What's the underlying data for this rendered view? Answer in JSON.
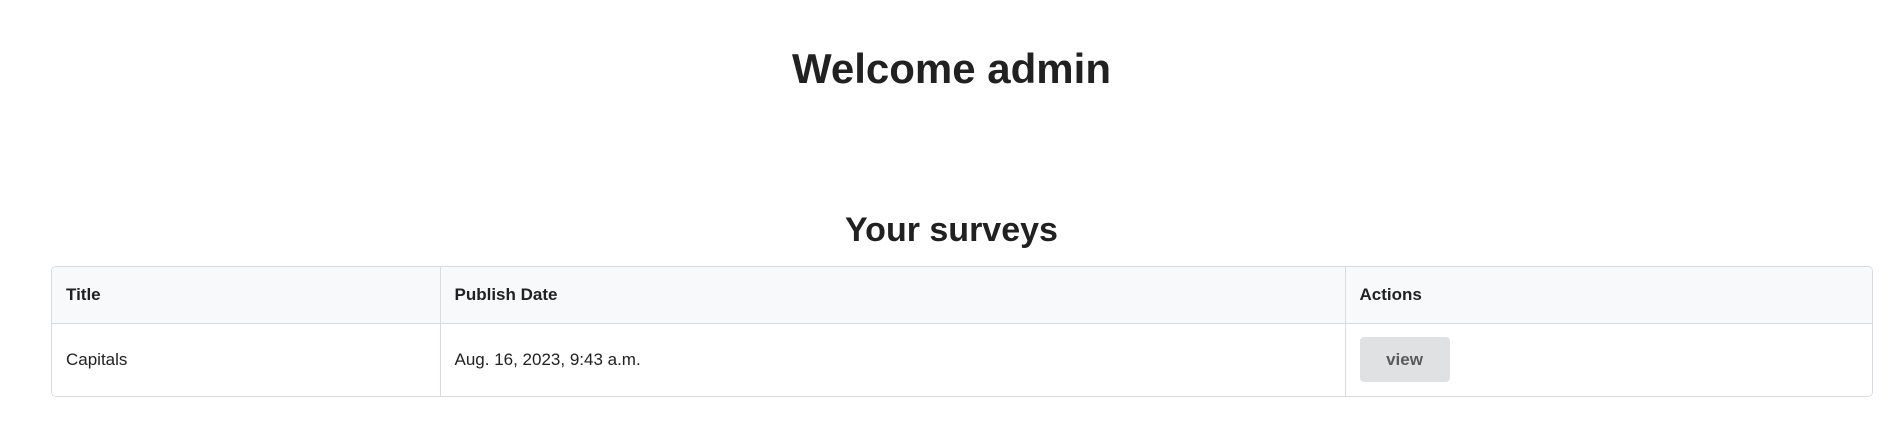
{
  "header": {
    "welcome": "Welcome admin"
  },
  "surveys": {
    "heading": "Your surveys",
    "columns": [
      "Title",
      "Publish Date",
      "Actions"
    ],
    "rows": [
      {
        "title": "Capitals",
        "publish_date": "Aug. 16, 2023, 9:43 a.m.",
        "action_label": "view"
      }
    ]
  }
}
